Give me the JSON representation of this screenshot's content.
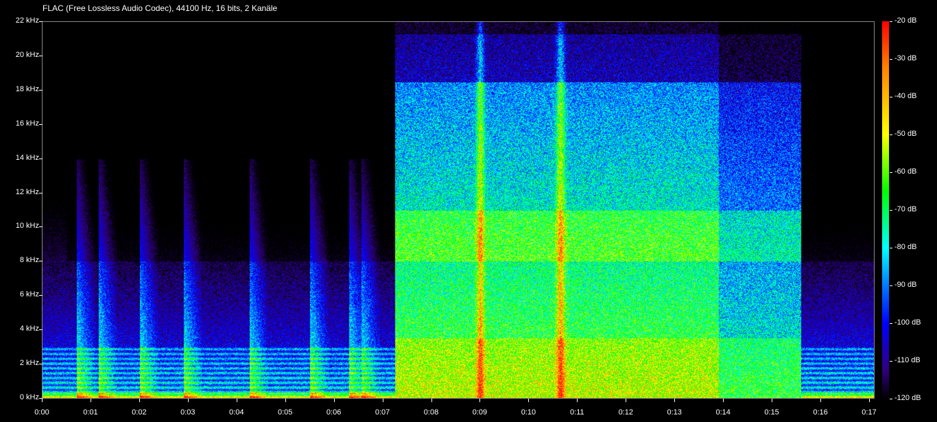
{
  "title": "FLAC (Free Lossless Audio Codec), 44100 Hz, 16 bits, 2 Kanäle",
  "chart_data": {
    "type": "heatmap",
    "title": "FLAC (Free Lossless Audio Codec), 44100 Hz, 16 bits, 2 Kanäle",
    "xlabel": "",
    "ylabel": "",
    "y_range_khz": [
      0,
      22
    ],
    "x_range_seconds": [
      0,
      17.1
    ],
    "y_ticks": [
      "0 kHz",
      "2 kHz",
      "4 kHz",
      "6 kHz",
      "8 kHz",
      "10 kHz",
      "12 kHz",
      "14 kHz",
      "16 kHz",
      "18 kHz",
      "20 kHz",
      "22 kHz"
    ],
    "x_ticks": [
      "0:00",
      "0:01",
      "0:02",
      "0:03",
      "0:04",
      "0:05",
      "0:06",
      "0:07",
      "0:08",
      "0:09",
      "0:10",
      "0:11",
      "0:12",
      "0:13",
      "0:14",
      "0:15",
      "0:16",
      "0:17"
    ],
    "colorbar_ticks": [
      "-20 dB",
      "-30 dB",
      "-40 dB",
      "-50 dB",
      "-60 dB",
      "-70 dB",
      "-80 dB",
      "-90 dB",
      "-100 dB",
      "-110 dB",
      "-120 dB"
    ],
    "colorbar_range_db": [
      -120,
      -20
    ],
    "colormap": [
      "#000000",
      "#300080",
      "#0000ff",
      "#0060ff",
      "#00ffff",
      "#00ff00",
      "#ffff00",
      "#ff7f00",
      "#ff0000"
    ],
    "grid": false
  }
}
